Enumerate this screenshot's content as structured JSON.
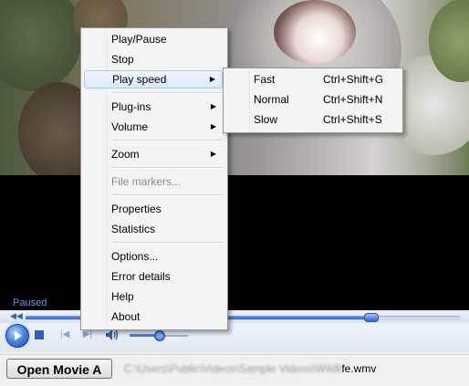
{
  "player": {
    "status": "Paused"
  },
  "main_menu": {
    "items": [
      {
        "label": "Play/Pause"
      },
      {
        "label": "Stop"
      },
      {
        "label": "Play speed",
        "submenu": true
      },
      {
        "label": "Plug-ins",
        "submenu": true
      },
      {
        "label": "Volume",
        "submenu": true
      },
      {
        "label": "Zoom",
        "submenu": true
      },
      {
        "label": "File markers...",
        "disabled": true
      },
      {
        "label": "Properties"
      },
      {
        "label": "Statistics"
      },
      {
        "label": "Options..."
      },
      {
        "label": "Error details"
      },
      {
        "label": "Help"
      },
      {
        "label": "About"
      }
    ],
    "arrow_glyph": "▶"
  },
  "play_speed_menu": {
    "items": [
      {
        "label": "Fast",
        "shortcut": "Ctrl+Shift+G"
      },
      {
        "label": "Normal",
        "shortcut": "Ctrl+Shift+N"
      },
      {
        "label": "Slow",
        "shortcut": "Ctrl+Shift+S"
      }
    ]
  },
  "bottom_bar": {
    "open_button_label": "Open Movie A",
    "file_path_blurred": "C:\\Users\\Public\\Videos\\Sample Videos\\Wildli",
    "file_path_visible": "fe.wmv"
  },
  "controls": {
    "seek_progress": 0.8,
    "volume_level": 0.5
  },
  "colors": {
    "accent": "#2f5fb6",
    "status_text": "#6f8fe0",
    "highlight_border": "#a9c7ef"
  }
}
